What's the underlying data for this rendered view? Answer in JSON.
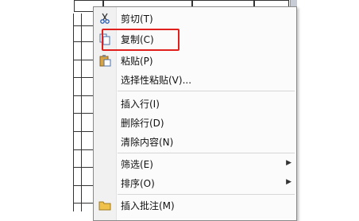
{
  "menu": {
    "items": [
      {
        "label": "剪切(T)",
        "icon": "scissors-icon"
      },
      {
        "label": "复制(C)",
        "icon": "copy-icon"
      },
      {
        "label": "粘贴(P)",
        "icon": "paste-icon"
      },
      {
        "label": "选择性粘贴(V)...",
        "icon": ""
      },
      {
        "label": "插入行(I)",
        "icon": ""
      },
      {
        "label": "删除行(D)",
        "icon": ""
      },
      {
        "label": "清除内容(N)",
        "icon": ""
      },
      {
        "label": "筛选(E)",
        "icon": "",
        "submenu": true
      },
      {
        "label": "排序(O)",
        "icon": "",
        "submenu": true
      },
      {
        "label": "插入批注(M)",
        "icon": "insert-comment-icon"
      }
    ]
  },
  "colors": {
    "highlight_border": "#e0201c",
    "menu_bg": "#fbfbfb",
    "gutter_bg": "#f1f1f1"
  }
}
